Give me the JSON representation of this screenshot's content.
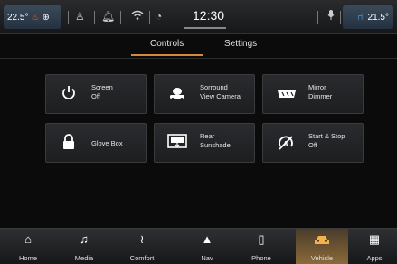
{
  "status_bar": {
    "temp_left": "22.5°",
    "temp_right": "21.5°",
    "time": "12:30"
  },
  "tabs": {
    "controls": "Controls",
    "settings": "Settings"
  },
  "controls": {
    "screen": {
      "line1": "Screen",
      "line2": "Off"
    },
    "surround_view": {
      "line1": "Sorround",
      "line2": "View Camera"
    },
    "mirror_dimmer": {
      "line1": "Mirror",
      "line2": "Dimmer"
    },
    "glove_box": {
      "line1": "Glove Box"
    },
    "rear_sunshade": {
      "line1": "Rear",
      "line2": "Sunshade"
    },
    "start_stop": {
      "line1": "Start & Stop",
      "line2": "Off"
    }
  },
  "nav": {
    "home": "Home",
    "media": "Media",
    "comfort": "Comfort",
    "nav": "Nav",
    "phone": "Phone",
    "vehicle": "Vehicle",
    "apps": "Apps"
  },
  "colors": {
    "accent": "#d58a3a",
    "active_nav_icon": "#f2b24c",
    "heated_seat": "#ff6a2a",
    "cooled_seat": "#5fb8ff"
  }
}
